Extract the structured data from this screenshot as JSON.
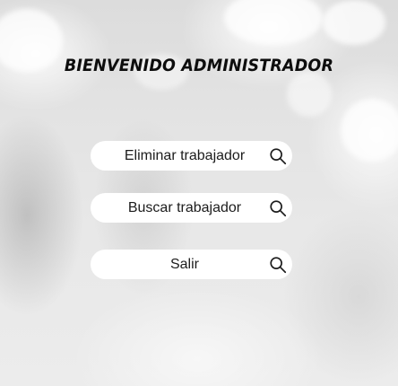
{
  "header": {
    "title": "BIENVENIDO ADMINISTRADOR"
  },
  "menu": {
    "buttons": [
      {
        "label": "Eliminar trabajador",
        "icon": "search-icon"
      },
      {
        "label": "Buscar trabajador",
        "icon": "search-icon"
      },
      {
        "label": "Salir",
        "icon": "search-icon"
      }
    ]
  },
  "colors": {
    "title": "#0d0d0d",
    "button_bg": "#ffffff",
    "button_text": "#1c1c1c",
    "background": "#e9e9e9"
  }
}
